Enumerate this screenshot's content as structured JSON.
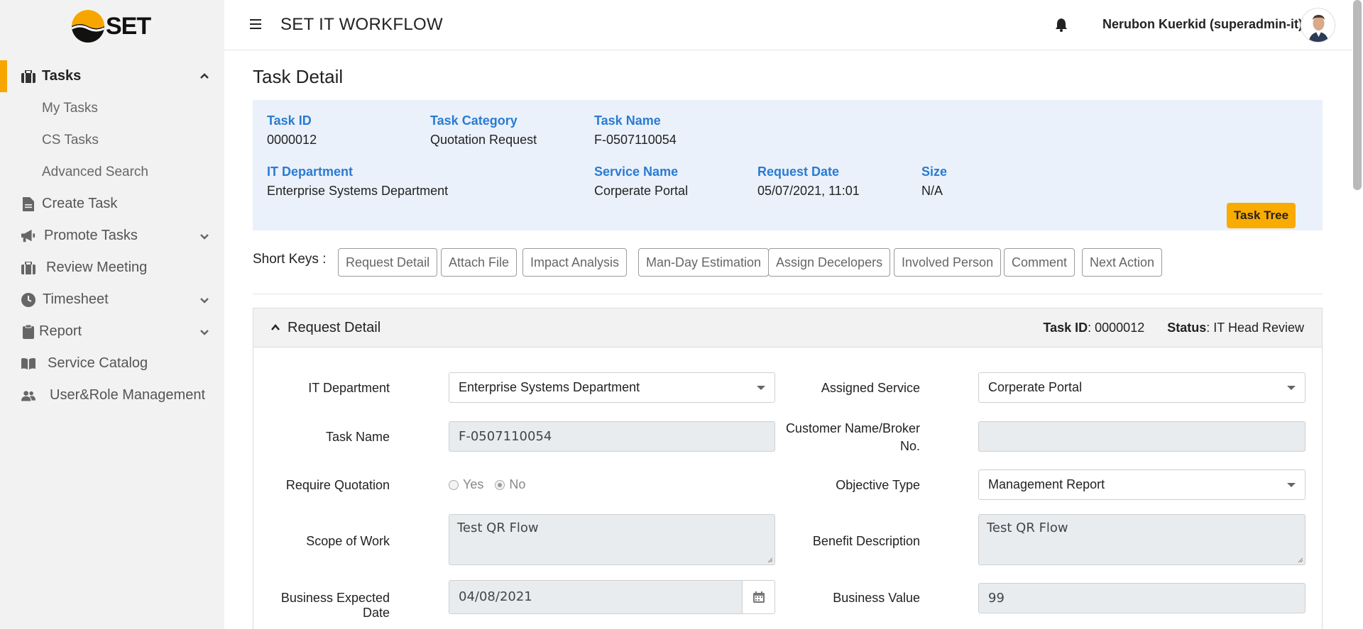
{
  "brand": {
    "logo_text": "SET"
  },
  "sidebar": {
    "items": [
      {
        "label": "Tasks",
        "icon": "briefcase-icon",
        "active": true,
        "expanded": true
      },
      {
        "label": "My Tasks"
      },
      {
        "label": "CS Tasks"
      },
      {
        "label": "Advanced Search"
      },
      {
        "label": "Create Task",
        "icon": "file-icon"
      },
      {
        "label": "Promote Tasks",
        "icon": "megaphone-icon"
      },
      {
        "label": "Review Meeting",
        "icon": "briefcase-icon"
      },
      {
        "label": "Timesheet",
        "icon": "clock-icon"
      },
      {
        "label": "Report",
        "icon": "clipboard-icon"
      },
      {
        "label": "Service Catalog",
        "icon": "book-icon"
      },
      {
        "label": "User&Role Management",
        "icon": "users-icon"
      }
    ]
  },
  "topbar": {
    "title": "SET IT WORKFLOW",
    "user": "Nerubon Kuerkid (superadmin-it)"
  },
  "page": {
    "title": "Task Detail"
  },
  "summary": {
    "task_id_label": "Task ID",
    "task_id": "0000012",
    "category_label": "Task Category",
    "category": "Quotation Request",
    "name_label": "Task Name",
    "name": "F-0507110054",
    "dept_label": "IT Department",
    "dept": "Enterprise Systems Department",
    "service_label": "Service Name",
    "service": "Corperate Portal",
    "date_label": "Request Date",
    "date": "05/07/2021, 11:01",
    "size_label": "Size",
    "size": "N/A",
    "task_tree": "Task Tree"
  },
  "shortkeys": {
    "label": "Short Keys :",
    "buttons": [
      "Request Detail",
      "Attach File",
      "Impact Analysis",
      "Man-Day Estimation",
      "Assign Decelopers",
      "Involved Person",
      "Comment",
      "Next Action"
    ]
  },
  "panel": {
    "title": "Request Detail",
    "task_id_label": "Task ID",
    "task_id": ": 0000012",
    "status_label": "Status",
    "status": ": IT Head Review",
    "fields": {
      "it_dept_label": "IT Department",
      "it_dept": "Enterprise Systems Department",
      "assigned_service_label": "Assigned Service",
      "assigned_service": "Corperate Portal",
      "task_name_label": "Task Name",
      "task_name": "F-0507110054",
      "customer_label_1": "Customer Name/Broker",
      "customer_label_2": "No.",
      "customer": "",
      "require_quotation_label": "Require Quotation",
      "yes": "Yes",
      "no": "No",
      "require_quotation": "No",
      "objective_type_label": "Objective Type",
      "objective_type": "Management Report",
      "scope_label": "Scope of Work",
      "scope": "Test QR Flow",
      "benefit_label": "Benefit Description",
      "benefit": "Test QR Flow",
      "expected_date_label": "Business Expected Date",
      "expected_date": "04/08/2021",
      "business_value_label": "Business Value",
      "business_value": "99"
    }
  },
  "colors": {
    "accent": "#f7a600",
    "label_blue": "#2a7bd1",
    "summary_bg": "#eaf1fb"
  }
}
